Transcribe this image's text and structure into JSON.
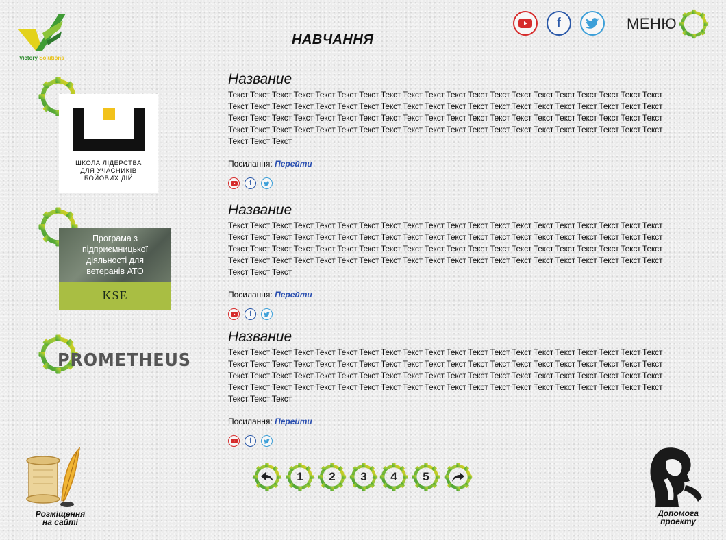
{
  "brand": {
    "name_part1": "Victory",
    "name_part2": "Solutions"
  },
  "header": {
    "title": "НАВЧАННЯ",
    "menu_label": "МЕНЮ",
    "social_icons": [
      "youtube-icon",
      "facebook-icon",
      "twitter-icon"
    ]
  },
  "cards": [
    {
      "logo_lines": [
        "ШКОЛА ЛІДЕРСТВА",
        "ДЛЯ УЧАСНИКІВ",
        "БОЙОВИХ ДІЙ"
      ]
    },
    {
      "banner_lines": [
        "Програма з",
        "підприємницької",
        "діяльності для",
        "ветеранів АТО"
      ],
      "banner_brand": "KSE"
    },
    {
      "logo_text": "PROMETHEUS"
    }
  ],
  "articles": [
    {
      "title": "Название",
      "body": "Текст Текст Текст Текст Текст Текст Текст Текст Текст Текст Текст Текст Текст Текст Текст Текст Текст Текст Текст Текст Текст Текст Текст Текст Текст Текст Текст Текст Текст Текст Текст Текст Текст Текст Текст Текст Текст Текст Текст Текст Текст Текст Текст Текст Текст Текст Текст Текст Текст Текст Текст Текст Текст Текст Текст Текст Текст Текст Текст Текст Текст Текст Текст Текст Текст Текст Текст Текст Текст Текст Текст Текст Текст Текст Текст Текст Текст Текст Текст Текст Текст Текст Текст",
      "link_label": "Посилання:",
      "link_text": "Перейти"
    },
    {
      "title": "Название",
      "body": "Текст Текст Текст Текст Текст Текст Текст Текст Текст Текст Текст Текст Текст Текст Текст Текст Текст Текст Текст Текст Текст Текст Текст Текст Текст Текст Текст Текст Текст Текст Текст Текст Текст Текст Текст Текст Текст Текст Текст Текст Текст Текст Текст Текст Текст Текст Текст Текст Текст Текст Текст Текст Текст Текст Текст Текст Текст Текст Текст Текст Текст Текст Текст Текст Текст Текст Текст Текст Текст Текст Текст Текст Текст Текст Текст Текст Текст Текст Текст Текст Текст Текст Текст",
      "link_label": "Посилання:",
      "link_text": "Перейти"
    },
    {
      "title": "Название",
      "body": "Текст Текст Текст Текст Текст Текст Текст Текст Текст Текст Текст Текст Текст Текст Текст Текст Текст Текст Текст Текст Текст Текст Текст Текст Текст Текст Текст Текст Текст Текст Текст Текст Текст Текст Текст Текст Текст Текст Текст Текст Текст Текст Текст Текст Текст Текст Текст Текст Текст Текст Текст Текст Текст Текст Текст Текст Текст Текст Текст Текст Текст Текст Текст Текст Текст Текст Текст Текст Текст Текст Текст Текст Текст Текст Текст Текст Текст Текст Текст Текст Текст Текст Текст",
      "link_label": "Посилання:",
      "link_text": "Перейти"
    }
  ],
  "pagination": {
    "pages": [
      "1",
      "2",
      "3",
      "4",
      "5"
    ]
  },
  "footer": {
    "placement_line1": "Розміщення",
    "placement_line2": "на сайті",
    "help_line1": "Допомога",
    "help_line2": "проекту"
  },
  "colors": {
    "gear_green": "#3f9c35",
    "gear_yellow": "#e3d21b",
    "youtube": "#d62b2b",
    "facebook": "#2a58a8",
    "twitter": "#3c9fd8",
    "link": "#2a4fb0",
    "kse_green": "#a9be43"
  }
}
